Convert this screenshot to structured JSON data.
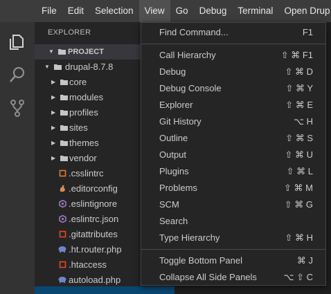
{
  "menubar": {
    "items": [
      {
        "label": "File"
      },
      {
        "label": "Edit"
      },
      {
        "label": "Selection"
      },
      {
        "label": "View",
        "active": true
      },
      {
        "label": "Go"
      },
      {
        "label": "Debug"
      },
      {
        "label": "Terminal"
      },
      {
        "label": "Open Drup"
      }
    ]
  },
  "activitybar": {
    "icons": [
      "files-icon",
      "search-icon",
      "source-control-icon"
    ]
  },
  "sidebar": {
    "title": "EXPLORER",
    "project_label": "PROJECT",
    "root_folder": "drupal-8.7.8",
    "folders": [
      "core",
      "modules",
      "profiles",
      "sites",
      "themes",
      "vendor"
    ],
    "files": [
      {
        "name": ".csslintrc",
        "icon": "css-file-icon",
        "color": "#e37933"
      },
      {
        "name": ".editorconfig",
        "icon": "editorconfig-icon",
        "color": "#d98e4f"
      },
      {
        "name": ".eslintignore",
        "icon": "eslint-icon",
        "color": "#a074c4"
      },
      {
        "name": ".eslintrc.json",
        "icon": "eslint-icon",
        "color": "#a074c4"
      },
      {
        "name": ".gitattributes",
        "icon": "git-file-icon",
        "color": "#e64a19"
      },
      {
        "name": ".ht.router.php",
        "icon": "php-icon",
        "color": "#6e86c9"
      },
      {
        "name": ".htaccess",
        "icon": "htaccess-icon",
        "color": "#e64a19"
      },
      {
        "name": "autoload.php",
        "icon": "php-icon",
        "color": "#6e86c9"
      }
    ]
  },
  "view_menu": {
    "groups": [
      [
        {
          "label": "Find Command...",
          "shortcut": "F1"
        }
      ],
      [
        {
          "label": "Call Hierarchy",
          "shortcut": "⇧ ⌘ F1"
        },
        {
          "label": "Debug",
          "shortcut": "⇧ ⌘ D"
        },
        {
          "label": "Debug Console",
          "shortcut": "⇧ ⌘ Y"
        },
        {
          "label": "Explorer",
          "shortcut": "⇧ ⌘ E"
        },
        {
          "label": "Git History",
          "shortcut": "⌥ H"
        },
        {
          "label": "Outline",
          "shortcut": "⇧ ⌘ S"
        },
        {
          "label": "Output",
          "shortcut": "⇧ ⌘ U"
        },
        {
          "label": "Plugins",
          "shortcut": "⇧ ⌘ L"
        },
        {
          "label": "Problems",
          "shortcut": "⇧ ⌘ M"
        },
        {
          "label": "SCM",
          "shortcut": "⇧ ⌘ G"
        },
        {
          "label": "Search",
          "shortcut": ""
        },
        {
          "label": "Type Hierarchy",
          "shortcut": "⇧ ⌘ H"
        }
      ],
      [
        {
          "label": "Toggle Bottom Panel",
          "shortcut": "⌘ J"
        },
        {
          "label": "Collapse All Side Panels",
          "shortcut": "⌥ ⇧ C"
        }
      ]
    ]
  },
  "colors": {
    "accent": "#094771",
    "menubar_bg": "#3c3c3c",
    "menu_bg": "#252526",
    "folder": "#c5c5c5"
  }
}
